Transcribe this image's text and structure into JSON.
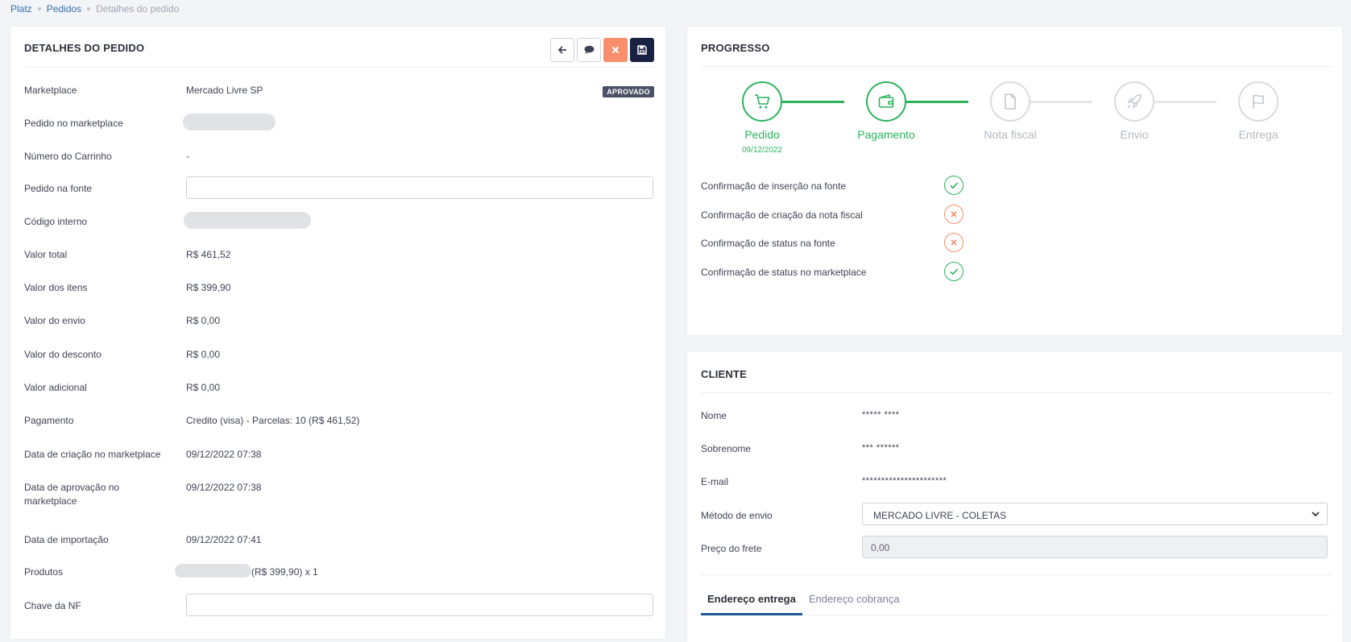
{
  "breadcrumb": [
    "Platz",
    "Pedidos",
    "Detalhes do pedido"
  ],
  "order": {
    "title": "DETALHES DO PEDIDO",
    "status_badge": "APROVADO",
    "toolbar": [
      "back-arrow-icon",
      "comment-icon",
      "close-icon",
      "save-icon"
    ],
    "fields": [
      {
        "label": "Marketplace",
        "value": "Mercado Livre SP"
      },
      {
        "label": "Pedido no marketplace",
        "value": ""
      },
      {
        "label": "Número do Carrinho",
        "value": "-"
      },
      {
        "label": "Pedido na fonte",
        "value": ""
      },
      {
        "label": "Código interno",
        "value": ""
      },
      {
        "label": "Valor total",
        "value": "R$ 461,52"
      },
      {
        "label": "Valor dos itens",
        "value": "R$ 399,90"
      },
      {
        "label": "Valor do envio",
        "value": "R$ 0,00"
      },
      {
        "label": "Valor do desconto",
        "value": "R$ 0,00"
      },
      {
        "label": "Valor adicional",
        "value": "R$ 0,00"
      },
      {
        "label": "Pagamento",
        "value": "Credito (visa) - Parcelas: 10 (R$ 461,52)"
      },
      {
        "label": "Data de criação no marketplace",
        "value": "09/12/2022 07:38"
      },
      {
        "label": "Data de aprovação no marketplace",
        "value": "09/12/2022 07:38"
      },
      {
        "label": "Data de importação",
        "value": "09/12/2022 07:41"
      },
      {
        "label": "Produtos",
        "value": "(R$ 399,90) x 1"
      },
      {
        "label": "Chave da NF",
        "value": ""
      }
    ]
  },
  "progress": {
    "title": "PROGRESSO",
    "steps": [
      {
        "label": "Pedido",
        "date": "09/12/2022",
        "done": true,
        "icon": "cart-icon"
      },
      {
        "label": "Pagamento",
        "date": "",
        "done": true,
        "icon": "wallet-icon"
      },
      {
        "label": "Nota fiscal",
        "date": "",
        "done": false,
        "icon": "document-icon"
      },
      {
        "label": "Envio",
        "date": "",
        "done": false,
        "icon": "rocket-icon"
      },
      {
        "label": "Entrega",
        "date": "",
        "done": false,
        "icon": "flag-icon"
      }
    ],
    "checks": [
      {
        "label": "Confirmação de inserção na fonte",
        "ok": true
      },
      {
        "label": "Confirmação de criação da nota fiscal",
        "ok": false
      },
      {
        "label": "Confirmação de status na fonte",
        "ok": false
      },
      {
        "label": "Confirmação de status no marketplace",
        "ok": true
      }
    ]
  },
  "client": {
    "title": "CLIENTE",
    "nome_label": "Nome",
    "nome": "***** ****",
    "sobrenome_label": "Sobrenome",
    "sobrenome": "*** ******",
    "email_label": "E-mail",
    "email": "**********************",
    "envio_label": "Método de envio",
    "envio": "MERCADO LIVRE - COLETAS",
    "frete_label": "Preço do frete",
    "frete": "0,00",
    "tabs": [
      "Endereço entrega",
      "Endereço cobrança"
    ]
  },
  "colors": {
    "success": "#2db35d",
    "danger": "#f98e6c",
    "primary_dark": "#1a2243",
    "link": "#3a6fb0"
  }
}
